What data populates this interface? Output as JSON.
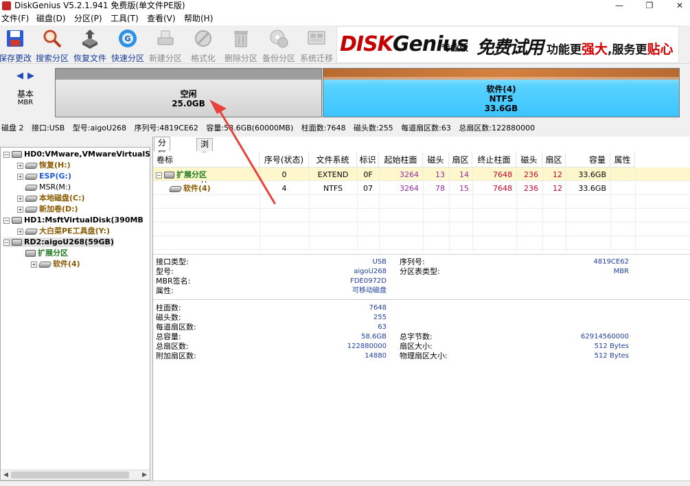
{
  "window": {
    "title": "DiskGenius V5.2.1.941 免费版(单文件PE版)",
    "minimize": "—",
    "maximize": "❐",
    "close": "✕"
  },
  "menu": [
    "文件(F)",
    "磁盘(D)",
    "分区(P)",
    "工具(T)",
    "查看(V)",
    "帮助(H)"
  ],
  "toolbar": [
    {
      "label": "保存更改",
      "icon": "save-icon",
      "enabled": true
    },
    {
      "label": "搜索分区",
      "icon": "search-icon",
      "enabled": true
    },
    {
      "label": "恢复文件",
      "icon": "recover-icon",
      "enabled": true
    },
    {
      "label": "快速分区",
      "icon": "quick-partition-icon",
      "enabled": true
    },
    {
      "label": "新建分区",
      "icon": "new-partition-icon",
      "enabled": false
    },
    {
      "label": "格式化",
      "icon": "format-icon",
      "enabled": false
    },
    {
      "label": "删除分区",
      "icon": "delete-icon",
      "enabled": false
    },
    {
      "label": "备份分区",
      "icon": "backup-icon",
      "enabled": false
    },
    {
      "label": "系统迁移",
      "icon": "migrate-icon",
      "enabled": false
    }
  ],
  "banner": {
    "logo_main": "DISK",
    "logo_k": "Genius",
    "edition": "专业版",
    "trial": "免费试用",
    "slogan_a": "功能更",
    "slogan_b": "强大",
    "slogan_c": ",服务更",
    "slogan_d": "贴心"
  },
  "diskmap": {
    "nav_left": "◀",
    "nav_right": "▶",
    "disk_type": "基本",
    "scheme": "MBR",
    "free": {
      "name": "空闲",
      "size": "25.0GB"
    },
    "ntfs": {
      "name": "软件(4)",
      "fs": "NTFS",
      "size": "33.6GB"
    }
  },
  "diskinfo": {
    "disk": "磁盘 2",
    "interface": "接口:USB",
    "model": "型号:aigoU268",
    "serial": "序列号:4819CE62",
    "capacity": "容量:58.6GB(60000MB)",
    "cylinders": "柱面数:7648",
    "heads": "磁头数:255",
    "sectors_per_track": "每道扇区数:63",
    "total_sectors": "总扇区数:122880000"
  },
  "tree": [
    {
      "label": "HD0:VMware,VMwareVirtualS",
      "style": "t-disk",
      "exp": "−",
      "icon": "disk"
    },
    {
      "label": "恢复(H:)",
      "style": "t-brown",
      "exp": "+",
      "icon": "part"
    },
    {
      "label": "ESP(G:)",
      "style": "t-blue",
      "exp": "+",
      "icon": "part"
    },
    {
      "label": "MSR(M:)",
      "style": "t-plain",
      "exp": "",
      "icon": "part"
    },
    {
      "label": "本地磁盘(C:)",
      "style": "t-brown",
      "exp": "+",
      "icon": "part"
    },
    {
      "label": "新加卷(D:)",
      "style": "t-brown",
      "exp": "+",
      "icon": "part"
    },
    {
      "label": "HD1:MsftVirtualDisk(390MB",
      "style": "t-disk",
      "exp": "−",
      "icon": "disk"
    },
    {
      "label": "大白菜PE工具盘(Y:)",
      "style": "t-brown",
      "exp": "+",
      "icon": "part"
    },
    {
      "label": "RD2:aigoU268(59GB)",
      "style": "t-disk",
      "exp": "−",
      "icon": "disk"
    },
    {
      "label": "扩展分区",
      "style": "t-green",
      "exp": "",
      "icon": "disk"
    },
    {
      "label": "软件(4)",
      "style": "t-brown",
      "exp": "+",
      "icon": "part"
    }
  ],
  "tabs": [
    "分区参数",
    "浏览文件"
  ],
  "table": {
    "headers": [
      "卷标",
      "序号(状态)",
      "文件系统",
      "标识",
      "起始柱面",
      "磁头",
      "扇区",
      "终止柱面",
      "磁头",
      "扇区",
      "容量",
      "属性"
    ],
    "rows": [
      {
        "label": "扩展分区",
        "num": "0",
        "fs": "EXTEND",
        "id": "0F",
        "sc": "3264",
        "sh": "13",
        "ss": "14",
        "ec": "7648",
        "eh": "236",
        "es": "12",
        "cap": "33.6GB",
        "attr": ""
      },
      {
        "label": "软件(4)",
        "num": "4",
        "fs": "NTFS",
        "id": "07",
        "sc": "3264",
        "sh": "78",
        "ss": "15",
        "ec": "7648",
        "eh": "236",
        "es": "12",
        "cap": "33.6GB",
        "attr": ""
      }
    ]
  },
  "info1": {
    "left": [
      {
        "k": "接口类型:",
        "v": "USB"
      },
      {
        "k": "型号:",
        "v": "aigoU268"
      },
      {
        "k": "MBR签名:",
        "v": "FDE0972D"
      },
      {
        "k": "属性:",
        "v": "可移动磁盘"
      }
    ],
    "right": [
      {
        "k": "序列号:",
        "v": "4819CE62"
      },
      {
        "k": "分区表类型:",
        "v": "MBR"
      }
    ]
  },
  "info2": {
    "left": [
      {
        "k": "柱面数:",
        "v": "7648"
      },
      {
        "k": "磁头数:",
        "v": "255"
      },
      {
        "k": "每道扇区数:",
        "v": "63"
      },
      {
        "k": "总容量:",
        "v": "58.6GB"
      },
      {
        "k": "总扇区数:",
        "v": "122880000"
      },
      {
        "k": "附加扇区数:",
        "v": "14880"
      }
    ],
    "right": [
      {
        "k": "总字节数:",
        "v": "62914560000"
      },
      {
        "k": "扇区大小:",
        "v": "512 Bytes"
      },
      {
        "k": "物理扇区大小:",
        "v": "512 Bytes"
      }
    ]
  },
  "colors": {
    "accent": "#1f5bd6",
    "ntfs": "#3bc4ff",
    "annotation_arrow": "#e8413c"
  }
}
